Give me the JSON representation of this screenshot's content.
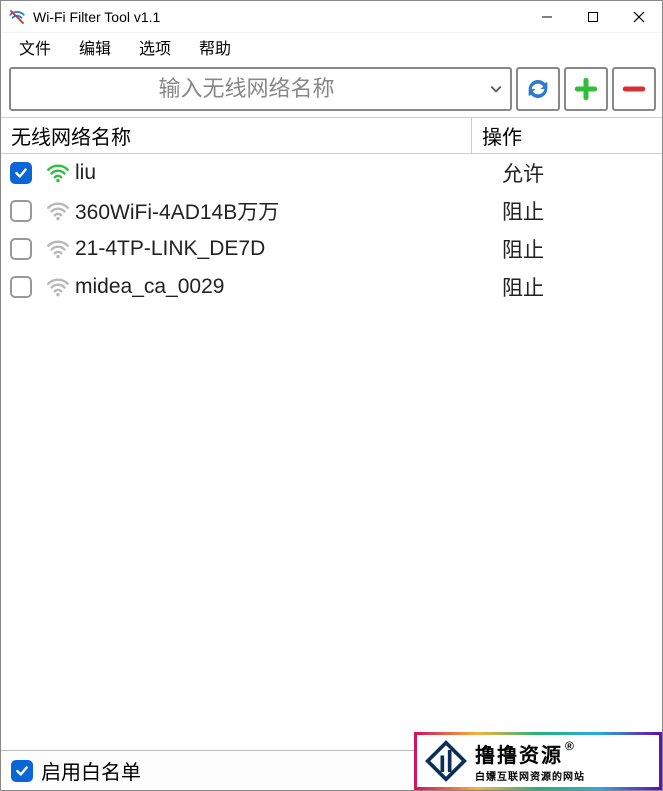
{
  "window": {
    "title": "Wi-Fi Filter Tool v1.1"
  },
  "menu": {
    "file": "文件",
    "edit": "编辑",
    "options": "选项",
    "help": "帮助"
  },
  "toolbar": {
    "placeholder": "输入无线网络名称"
  },
  "columns": {
    "name": "无线网络名称",
    "action": "操作"
  },
  "rows": [
    {
      "checked": true,
      "signal": "strong",
      "name": "liu",
      "action": "允许"
    },
    {
      "checked": false,
      "signal": "weak",
      "name": "360WiFi-4AD14B万万",
      "action": "阻止"
    },
    {
      "checked": false,
      "signal": "weak",
      "name": "21-4TP-LINK_DE7D",
      "action": "阻止"
    },
    {
      "checked": false,
      "signal": "weak",
      "name": "midea_ca_0029",
      "action": "阻止"
    }
  ],
  "footer": {
    "whitelist_label": "启用白名单",
    "whitelist_checked": true
  },
  "watermark": {
    "main": "撸撸资源",
    "reg": "®",
    "sub": "白嫖互联网资源的网站"
  },
  "colors": {
    "accent": "#0a66d6",
    "strong_wifi": "#2fbf3a",
    "weak_wifi": "#b8b8b8",
    "add": "#2fbf3a",
    "remove": "#d53131",
    "refresh": "#2a7bd1"
  }
}
